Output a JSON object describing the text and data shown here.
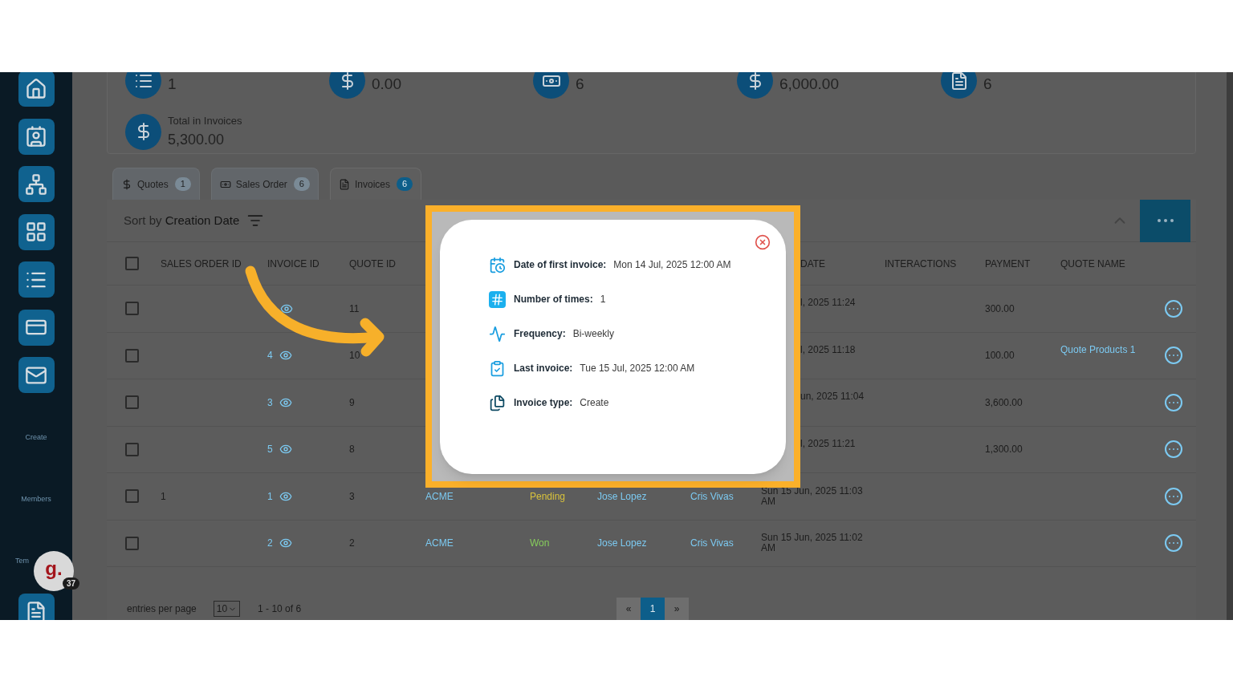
{
  "sidebar": {
    "labels": [
      "Create",
      "Members",
      "Tem"
    ]
  },
  "chat_widget": {
    "letter": "g.",
    "badge": "37"
  },
  "stats": [
    {
      "value": "1"
    },
    {
      "value": "0.00"
    },
    {
      "value": "6"
    },
    {
      "value": "6,000.00"
    },
    {
      "value": "6"
    }
  ],
  "total": {
    "label": "Total in Invoices",
    "value": "5,300.00"
  },
  "tabs": [
    {
      "label": "Quotes",
      "count": "1",
      "selected": false
    },
    {
      "label": "Sales Order",
      "count": "6",
      "selected": false
    },
    {
      "label": "Invoices",
      "count": "6",
      "selected": true
    }
  ],
  "toolbar": {
    "sort_prefix": "Sort by",
    "sort_field": "Creation Date"
  },
  "table": {
    "header_checked": false,
    "columns": [
      "SALES ORDER ID",
      "INVOICE ID",
      "QUOTE ID",
      "DATE",
      "INTERACTIONS",
      "PAYMENT",
      "QUOTE NAME"
    ],
    "rows": [
      {
        "checked": false,
        "quote_id": "11",
        "date": "l, 2025 11:24",
        "payment": "300.00"
      },
      {
        "checked": false,
        "invoice_id": "4",
        "quote_id": "10",
        "date": "l, 2025 11:18",
        "payment": "100.00",
        "quote_name": "Quote Products 1"
      },
      {
        "checked": false,
        "invoice_id": "3",
        "quote_id": "9",
        "date": "un, 2025 11:04",
        "payment": "3,600.00"
      },
      {
        "checked": false,
        "invoice_id": "5",
        "quote_id": "8",
        "date": "l, 2025 11:21",
        "payment": "1,300.00"
      },
      {
        "checked": false,
        "sales_order_id": "1",
        "invoice_id": "1",
        "quote_id": "3",
        "company": "ACME",
        "status": {
          "label": "Pending",
          "color": "#d8c23c"
        },
        "contact": "Jose Lopez",
        "owner": "Cris Vivas",
        "date": "Sun 15 Jun, 2025 11:03 AM"
      },
      {
        "checked": false,
        "invoice_id": "2",
        "quote_id": "2",
        "company": "ACME",
        "status": {
          "label": "Won",
          "color": "#86cc5c"
        },
        "contact": "Jose Lopez",
        "owner": "Cris Vivas",
        "date": "Sun 15 Jun, 2025 11:02 AM"
      }
    ]
  },
  "footer": {
    "entries_label": "entries per page",
    "page_size": "10",
    "range": "1 - 10 of 6",
    "pagination": [
      {
        "label": "«",
        "selected": false
      },
      {
        "label": "1",
        "selected": true
      },
      {
        "label": "»",
        "selected": false
      }
    ]
  },
  "popup": {
    "fields": [
      {
        "label": "Date of first invoice:",
        "value": "Mon 14 Jul, 2025 12:00 AM"
      },
      {
        "label": "Number of times:",
        "value": "1"
      },
      {
        "label": "Frequency:",
        "value": "Bi-weekly"
      },
      {
        "label": "Last invoice:",
        "value": "Tue 15 Jul, 2025 12:00 AM"
      },
      {
        "label": "Invoice type:",
        "value": "Create"
      }
    ]
  }
}
